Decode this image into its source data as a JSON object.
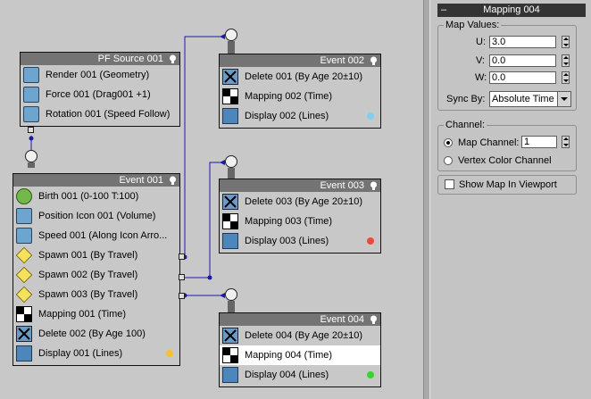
{
  "nodes": {
    "pf_source": {
      "title": "PF Source 001",
      "operators": [
        {
          "label": "Render 001 (Geometry)",
          "icon": "render-icon"
        },
        {
          "label": "Force 001 (Drag001 +1)",
          "icon": "force-icon"
        },
        {
          "label": "Rotation 001 (Speed Follow)",
          "icon": "rotation-icon"
        }
      ]
    },
    "event001": {
      "title": "Event 001",
      "operators": [
        {
          "label": "Birth 001 (0-100 T:100)",
          "icon": "birth-icon"
        },
        {
          "label": "Position Icon 001 (Volume)",
          "icon": "position-icon"
        },
        {
          "label": "Speed 001 (Along Icon Arro...",
          "icon": "speed-icon"
        },
        {
          "label": "Spawn 001 (By Travel)",
          "icon": "spawn-icon"
        },
        {
          "label": "Spawn 002 (By Travel)",
          "icon": "spawn-icon"
        },
        {
          "label": "Spawn 003 (By Travel)",
          "icon": "spawn-icon"
        },
        {
          "label": "Mapping 001 (Time)",
          "icon": "mapping-icon"
        },
        {
          "label": "Delete 002 (By Age 100)",
          "icon": "delete-icon"
        },
        {
          "label": "Display 001 (Lines)",
          "icon": "display-icon"
        }
      ],
      "display_color": "#f5c12d"
    },
    "event002": {
      "title": "Event 002",
      "operators": [
        {
          "label": "Delete 001 (By Age 20±10)",
          "icon": "delete-icon"
        },
        {
          "label": "Mapping 002 (Time)",
          "icon": "mapping-icon"
        },
        {
          "label": "Display 002 (Lines)",
          "icon": "display-icon"
        }
      ],
      "display_color": "#7fcff0"
    },
    "event003": {
      "title": "Event 003",
      "operators": [
        {
          "label": "Delete 003 (By Age 20±10)",
          "icon": "delete-icon"
        },
        {
          "label": "Mapping 003 (Time)",
          "icon": "mapping-icon"
        },
        {
          "label": "Display 003 (Lines)",
          "icon": "display-icon"
        }
      ],
      "display_color": "#f0483a"
    },
    "event004": {
      "title": "Event 004",
      "operators": [
        {
          "label": "Delete 004 (By Age 20±10)",
          "icon": "delete-icon"
        },
        {
          "label": "Mapping 004 (Time)",
          "icon": "mapping-icon"
        },
        {
          "label": "Display 004 (Lines)",
          "icon": "display-icon"
        }
      ],
      "display_color": "#35d62b"
    }
  },
  "panel": {
    "title": "Mapping 004",
    "map_values_label": "Map Values:",
    "u_label": "U:",
    "u_value": "3.0",
    "v_label": "V:",
    "v_value": "0.0",
    "w_label": "W:",
    "w_value": "0.0",
    "sync_by_label": "Sync By:",
    "sync_by_value": "Absolute Time",
    "channel_label": "Channel:",
    "map_channel_label": "Map Channel:",
    "map_channel_value": "1",
    "vertex_color_label": "Vertex Color Channel",
    "show_map_label": "Show Map In Viewport"
  },
  "colors": {
    "wire": "#1a1aa8",
    "title_bar": "#747474",
    "selection": "#ffffff"
  }
}
